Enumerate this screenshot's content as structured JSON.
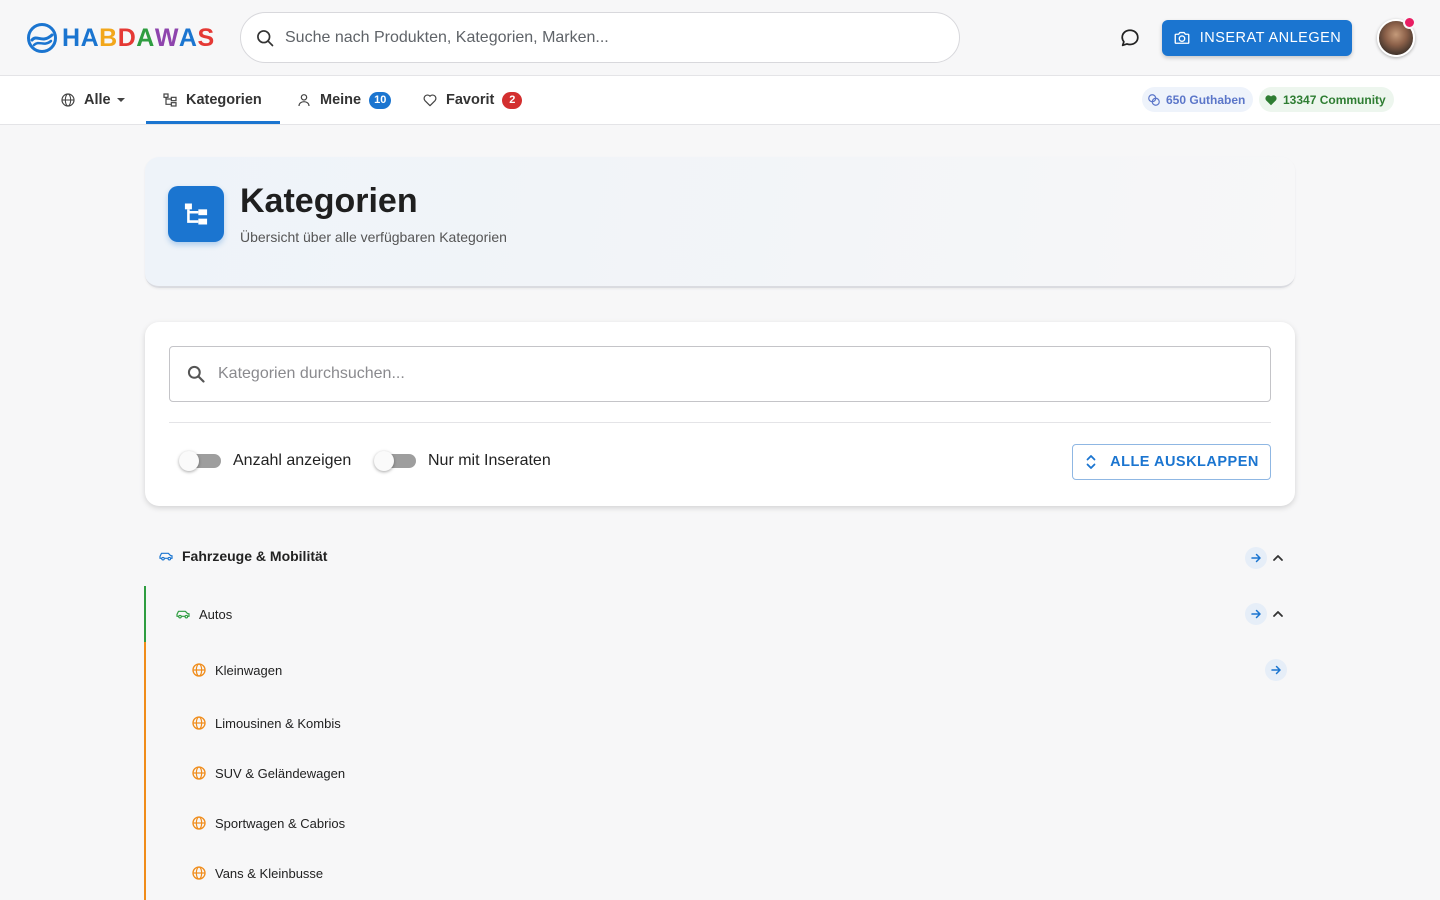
{
  "header": {
    "logo_text": "HABDAWAS",
    "search_placeholder": "Suche nach Produkten, Kategorien, Marken...",
    "create_button": "INSERAT ANLEGEN"
  },
  "nav": {
    "all_label": "Alle",
    "categories_label": "Kategorien",
    "mine_label": "Meine",
    "mine_count": "10",
    "favorite_label": "Favorit",
    "favorite_count": "2",
    "credit_chip": "650 Guthaben",
    "community_chip": "13347 Community"
  },
  "hero": {
    "title": "Kategorien",
    "subtitle": "Übersicht über alle verfügbaren Kategorien"
  },
  "filters": {
    "search_placeholder": "Kategorien durchsuchen...",
    "toggle_count_label": "Anzahl anzeigen",
    "toggle_count_on": false,
    "toggle_listings_label": "Nur mit Inseraten",
    "toggle_listings_on": false,
    "expand_all_label": "ALLE AUSKLAPPEN"
  },
  "tree": {
    "root": {
      "label": "Fahrzeuge & Mobilität",
      "icon": "car-icon",
      "expanded": true
    },
    "child": {
      "label": "Autos",
      "icon": "car-icon",
      "expanded": true
    },
    "leaves": [
      {
        "label": "Kleinwagen",
        "icon": "globe-icon"
      },
      {
        "label": "Limousinen & Kombis",
        "icon": "globe-icon"
      },
      {
        "label": "SUV & Geländewagen",
        "icon": "globe-icon"
      },
      {
        "label": "Sportwagen & Cabrios",
        "icon": "globe-icon"
      },
      {
        "label": "Vans & Kleinbusse",
        "icon": "globe-icon"
      }
    ]
  },
  "colors": {
    "primary": "#1b75d0",
    "level1_rail": "#2e9d40",
    "level2_rail": "#f08c1a",
    "badge_red": "#d32f2f",
    "notification_dot": "#e91e63"
  }
}
